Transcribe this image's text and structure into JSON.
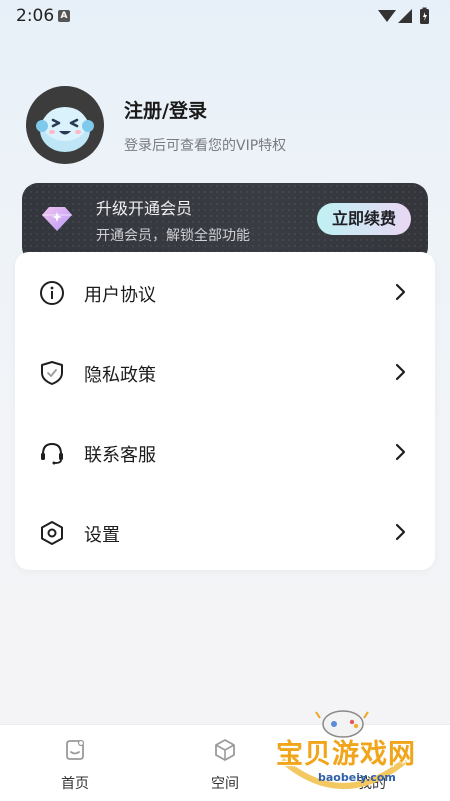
{
  "status_bar": {
    "time": "2:06",
    "notification_letter": "A"
  },
  "profile": {
    "title": "注册/登录",
    "subtitle": "登录后可查看您的VIP特权"
  },
  "vip": {
    "title": "升级开通会员",
    "subtitle": "开通会员，解锁全部功能",
    "button": "立即续费"
  },
  "menu": [
    {
      "label": "用户协议",
      "icon": "info-icon"
    },
    {
      "label": "隐私政策",
      "icon": "shield-icon"
    },
    {
      "label": "联系客服",
      "icon": "headset-icon"
    },
    {
      "label": "设置",
      "icon": "settings-hex-icon"
    }
  ],
  "bottom_nav": {
    "home": "首页",
    "space": "空间",
    "mine": "我的"
  },
  "watermark": {
    "text": "宝贝游戏网",
    "url": "baobeiy.com"
  },
  "colors": {
    "accent_gradient_start": "#bff1f3",
    "accent_gradient_end": "#e9d7f3",
    "vip_card_bg": "#36383f",
    "watermark_orange": "#f0a51b"
  }
}
